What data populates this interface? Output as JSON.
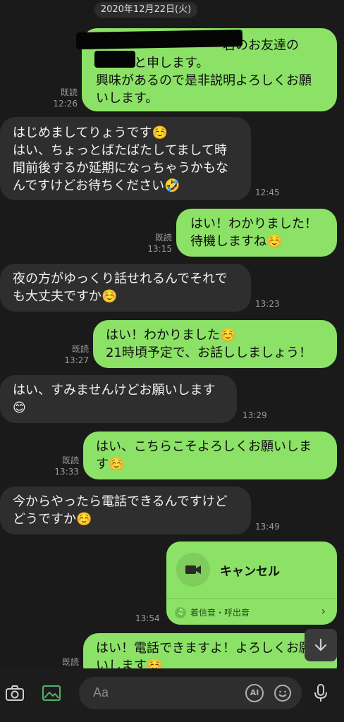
{
  "date_chip": "2020年12月22日(火)",
  "messages": [
    {
      "dir": "out",
      "text": "　　　　　　　　　　君のお友達の\n　　　と申します。\n興味があるので是非説明よろしくお願\nいします。",
      "read": "既読",
      "time": "12:26"
    },
    {
      "dir": "in",
      "text": "はじめましてりょうです☺️\nはい、ちょっとばたばたしてまして時\n間前後するか延期になっちゃうかもな\nんですけどお待ちください🤣",
      "time": "12:45"
    },
    {
      "dir": "out",
      "text": "はい！わかりました！\n待機しますね☺️",
      "read": "既読",
      "time": "13:15"
    },
    {
      "dir": "in",
      "text": "夜の方がゆっくり話せれるんでそれで\nも大丈夫ですか☺️",
      "time": "13:23"
    },
    {
      "dir": "out",
      "text": "はい！わかりました☺️\n21時頃予定で、お話ししましょう！",
      "read": "既読",
      "time": "13:27"
    },
    {
      "dir": "in",
      "text": "はい、すみませんけどお願いします\n😊",
      "time": "13:29"
    },
    {
      "dir": "out",
      "text": "はい、こちらこそよろしくお願いしま\nす☺️",
      "read": "既読",
      "time": "13:33"
    },
    {
      "dir": "in",
      "text": "今からやったら電話できるんですけど\nどうですか☺️",
      "time": "13:49"
    },
    {
      "dir": "out",
      "text": "はい！電話できますよ！よろしくお願\nいします☺️",
      "read": "既読",
      "time": ""
    }
  ],
  "call": {
    "title": "キャンセル",
    "sub": "着信音・呼出音",
    "time": "13:54",
    "icon": "video-camera-icon"
  },
  "input": {
    "placeholder": "Aa",
    "ai_label": "AI"
  },
  "colors": {
    "background": "#1a1a1a",
    "outgoing_bubble": "#8ce266",
    "incoming_bubble": "#2e2e2e",
    "meta_text": "#9a9a9a"
  },
  "icons": {
    "camera": "camera-icon",
    "gallery": "image-icon",
    "emoji": "emoji-icon",
    "mic": "microphone-icon",
    "scroll_down": "arrow-down-icon"
  }
}
